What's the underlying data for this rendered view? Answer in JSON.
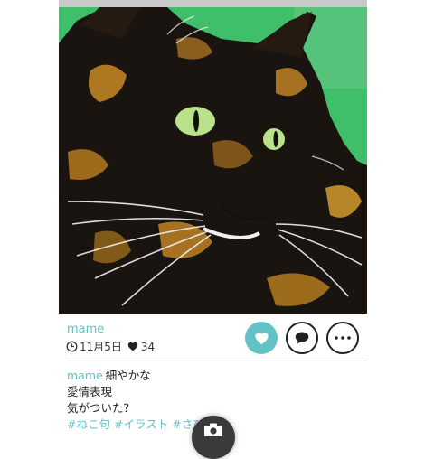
{
  "post": {
    "username": "mame",
    "date": "11月5日",
    "like_count": "34",
    "caption": {
      "author": "mame",
      "lines": [
        "細やかな",
        "愛情表現",
        "気がついた？"
      ],
      "tags": [
        "#ねこ句",
        "#イラスト",
        "#さびね"
      ]
    }
  },
  "icons": {
    "date": "clock-icon",
    "likes": "heart-icon",
    "like_button": "heart-icon",
    "comment_button": "speech-bubble-icon",
    "more_button": "ellipsis-icon",
    "floating_button": "camera-icon"
  },
  "colors": {
    "accent": "#63c2c5",
    "artwork_background": "#3fbf6a",
    "cat_fur": "#1a1410",
    "cat_eye": "#b9e28a",
    "cat_patch": "#c98a25"
  }
}
